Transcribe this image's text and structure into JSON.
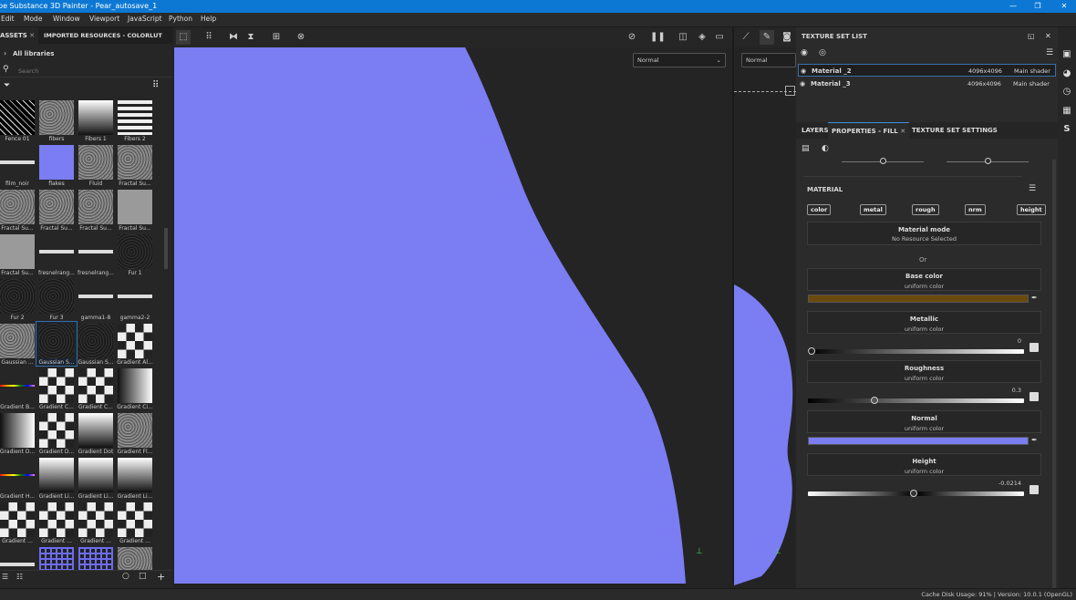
{
  "titlebar": {
    "title": "be Substance 3D Painter - Pear_autosave_1",
    "minimize": "—",
    "maximize": "❐",
    "close": "✕"
  },
  "menu": [
    "Edit",
    "Mode",
    "Window",
    "Viewport",
    "JavaScript",
    "Python",
    "Help"
  ],
  "assets": {
    "tabs": [
      "ASSETS",
      "IMPORTED RESOURCES - COLORLUT"
    ],
    "close_icon": "✕",
    "libraries": "All libraries",
    "search_placeholder": "Search",
    "items": [
      {
        "name": "Fence 01",
        "thumb": "fence"
      },
      {
        "name": "fibers",
        "thumb": "noise"
      },
      {
        "name": "Fibers 1",
        "thumb": "vgrad"
      },
      {
        "name": "Fibers 2",
        "thumb": "stripes"
      },
      {
        "name": "film_noir",
        "thumb": "line"
      },
      {
        "name": "flakes",
        "thumb": "normal"
      },
      {
        "name": "Fluid",
        "thumb": "noise"
      },
      {
        "name": "Fractal Su...",
        "thumb": "noise"
      },
      {
        "name": "Fractal Su...",
        "thumb": "noise"
      },
      {
        "name": "Fractal Su...",
        "thumb": "noise"
      },
      {
        "name": "Fractal Su...",
        "thumb": "noise"
      },
      {
        "name": "Fractal Su...",
        "thumb": "flat"
      },
      {
        "name": "Fractal Su...",
        "thumb": "flat"
      },
      {
        "name": "fresnelrang...",
        "thumb": "line"
      },
      {
        "name": "fresnelrang...",
        "thumb": "line"
      },
      {
        "name": "Fur 1",
        "thumb": "dark"
      },
      {
        "name": "Fur 2",
        "thumb": "dark"
      },
      {
        "name": "Fur 3",
        "thumb": "dark"
      },
      {
        "name": "gamma1-8",
        "thumb": "line"
      },
      {
        "name": "gamma2-2",
        "thumb": "line"
      },
      {
        "name": "Gaussian ...",
        "thumb": "noise"
      },
      {
        "name": "Gaussian S...",
        "thumb": "dark"
      },
      {
        "name": "Gaussian S...",
        "thumb": "dark"
      },
      {
        "name": "Gradient Al...",
        "thumb": "checker"
      },
      {
        "name": "Gradient B...",
        "thumb": "rainbow"
      },
      {
        "name": "Gradient C...",
        "thumb": "checker"
      },
      {
        "name": "Gradient C...",
        "thumb": "checker"
      },
      {
        "name": "Gradient Ci...",
        "thumb": "grad"
      },
      {
        "name": "Gradient D...",
        "thumb": "grad"
      },
      {
        "name": "Gradient D...",
        "thumb": "checker"
      },
      {
        "name": "Gradient Dot",
        "thumb": "vgrad"
      },
      {
        "name": "Gradient Fl...",
        "thumb": "noise"
      },
      {
        "name": "Gradient H...",
        "thumb": "rainbow"
      },
      {
        "name": "Gradient Li...",
        "thumb": "vgrad"
      },
      {
        "name": "Gradient Li...",
        "thumb": "vgrad"
      },
      {
        "name": "Gradient Li...",
        "thumb": "vgrad"
      },
      {
        "name": "Gradient ...",
        "thumb": "checker"
      },
      {
        "name": "Gradient ...",
        "thumb": "checker"
      },
      {
        "name": "Gradient ...",
        "thumb": "checker"
      },
      {
        "name": "Gradient ...",
        "thumb": "checker"
      },
      {
        "name": "",
        "thumb": "line"
      },
      {
        "name": "",
        "thumb": "bluegrid"
      },
      {
        "name": "",
        "thumb": "bluegrid"
      },
      {
        "name": "",
        "thumb": "noise"
      }
    ],
    "selected_index": 21
  },
  "viewport": {
    "mode_2d": "Normal",
    "mode_3d": "Normal",
    "normal_color": "#7b7df2"
  },
  "texture_set_list": {
    "title": "TEXTURE SET LIST",
    "rows": [
      {
        "name": "Material _2",
        "size": "4096x4096",
        "shader": "Main shader",
        "selected": true
      },
      {
        "name": "Material _3",
        "size": "4096x4096",
        "shader": "Main shader",
        "selected": false
      }
    ]
  },
  "properties": {
    "tabs": [
      "LAYERS",
      "PROPERTIES - FILL",
      "TEXTURE SET SETTINGS"
    ],
    "section": "MATERIAL",
    "chips": [
      "color",
      "metal",
      "rough",
      "nrm",
      "height"
    ],
    "material_mode": {
      "title": "Material mode",
      "sub": "No Resource Selected"
    },
    "or": "Or",
    "base_color": {
      "title": "Base color",
      "sub": "uniform color",
      "color": "#6b4a0e"
    },
    "metallic": {
      "title": "Metallic",
      "sub": "uniform color",
      "value": "0",
      "fraction": 0
    },
    "roughness": {
      "title": "Roughness",
      "sub": "uniform color",
      "value": "0.3",
      "fraction": 0.3
    },
    "normal": {
      "title": "Normal",
      "sub": "uniform color",
      "color": "#7b7df2"
    },
    "height": {
      "title": "Height",
      "sub": "uniform color",
      "value": "-0.0214",
      "fraction": 0.49
    }
  },
  "status": "Cache Disk Usage:   91% | Version: 10.0.1 (OpenGL)"
}
